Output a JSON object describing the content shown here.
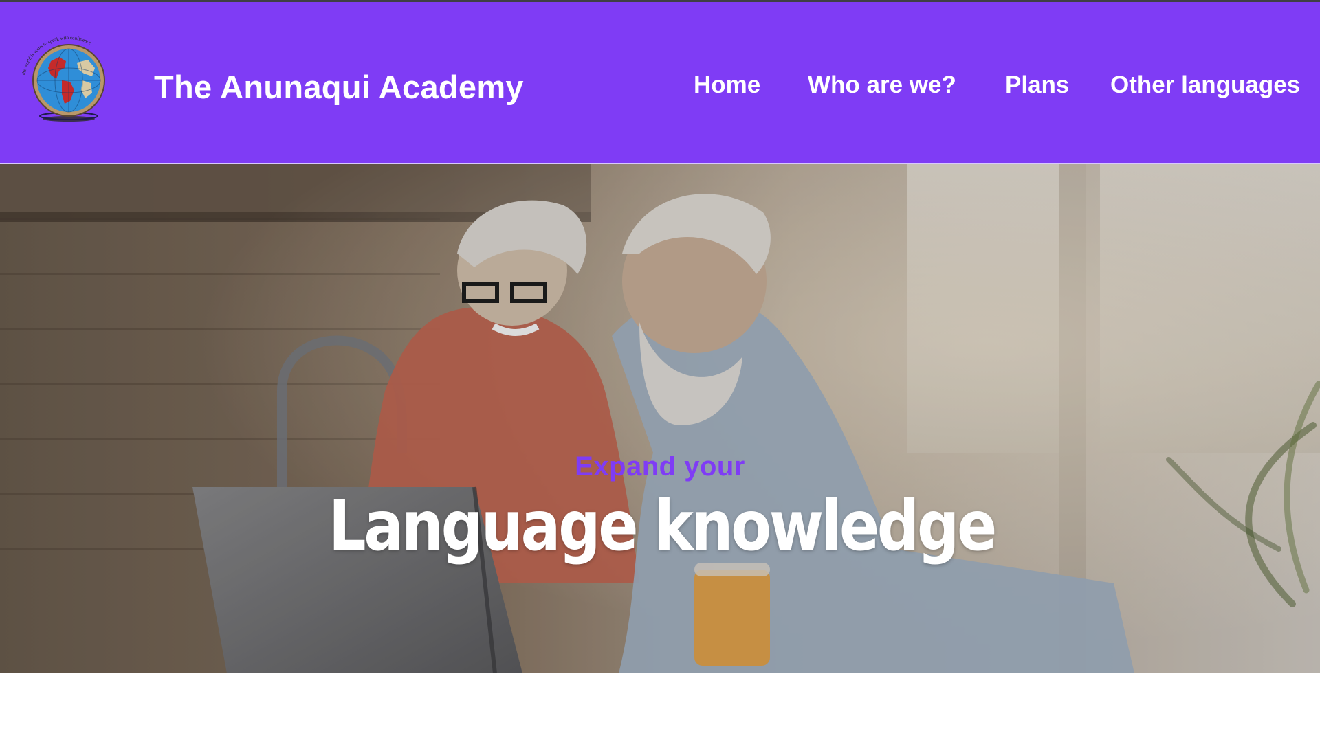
{
  "brand": {
    "title": "The Anunaqui Academy",
    "logo_icon": "globe-seal-icon",
    "logo_motto": "the world is yours to speak with confidence"
  },
  "nav": {
    "items": [
      {
        "label": "Home"
      },
      {
        "label": "Who are we?"
      },
      {
        "label": "Plans"
      },
      {
        "label": "Other languages"
      }
    ]
  },
  "hero": {
    "kicker": "Expand your",
    "headline": "Language knowledge",
    "image_subject": "couple-using-laptop-photo"
  },
  "colors": {
    "brand_purple": "#7f3cf5",
    "header_text": "#ffffff",
    "kicker_text": "#7f3cf5",
    "headline_text": "#ffffff"
  }
}
